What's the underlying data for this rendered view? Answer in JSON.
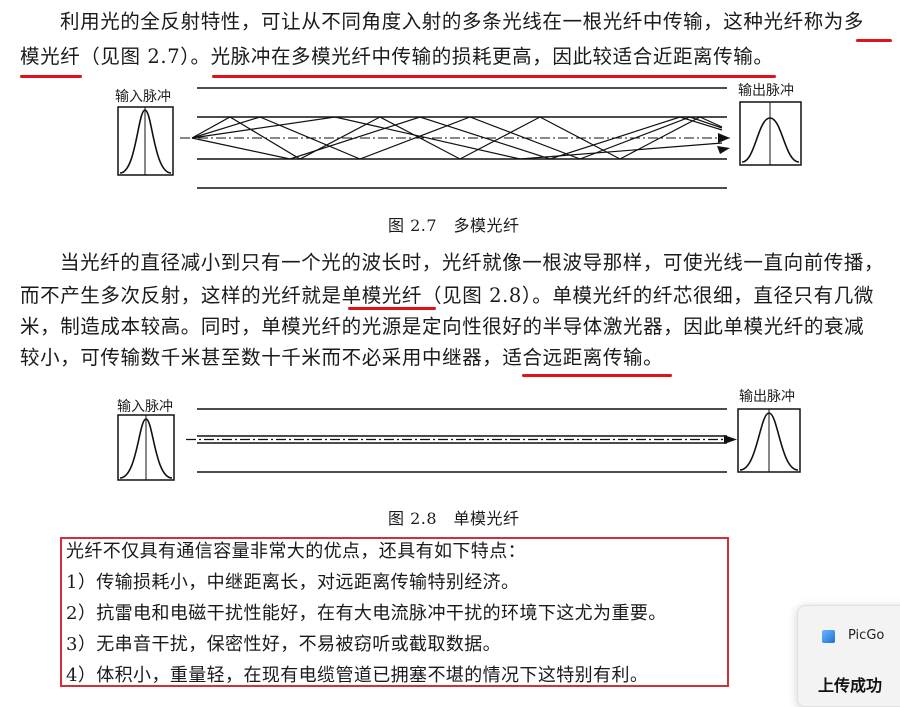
{
  "paragraph1": {
    "line1": "利用光的全反射特性，可让从不同角度入射的多条光线在一根光纤中传输，这种光纤称为多",
    "line2": "模光纤（见图 2.7）。光脉冲在多模光纤中传输的损耗更高，因此较适合近距离传输。"
  },
  "figure1": {
    "input_label": "输入脉冲",
    "output_label": "输出脉冲",
    "caption": "图 2.7　多模光纤"
  },
  "paragraph2": {
    "line1": "当光纤的直径减小到只有一个光的波长时，光纤就像一根波导那样，可使光线一直向前传播，",
    "line2": "而不产生多次反射，这样的光纤就是单模光纤（见图 2.8）。单模光纤的纤芯很细，直径只有几微",
    "line3": "米，制造成本较高。同时，单模光纤的光源是定向性很好的半导体激光器，因此单模光纤的衰减",
    "line4": "较小，可传输数千米甚至数十千米而不必采用中继器，适合远距离传输。"
  },
  "figure2": {
    "input_label": "输入脉冲",
    "output_label": "输出脉冲",
    "caption": "图 2.8　单模光纤"
  },
  "features": {
    "intro": "光纤不仅具有通信容量非常大的优点，还具有如下特点：",
    "items": [
      "1）传输损耗小，中继距离长，对远距离传输特别经济。",
      "2）抗雷电和电磁干扰性能好，在有大电流脉冲干扰的环境下这尤为重要。",
      "3）无串音干扰，保密性好，不易被窃听或截取数据。",
      "4）体积小，重量轻，在现有电缆管道已拥塞不堪的情况下这特别有利。"
    ]
  },
  "notification": {
    "app_name": "PicGo",
    "message": "上传成功"
  },
  "colors": {
    "annotation_red": "#e0131a",
    "box_red": "#d32f3a"
  }
}
